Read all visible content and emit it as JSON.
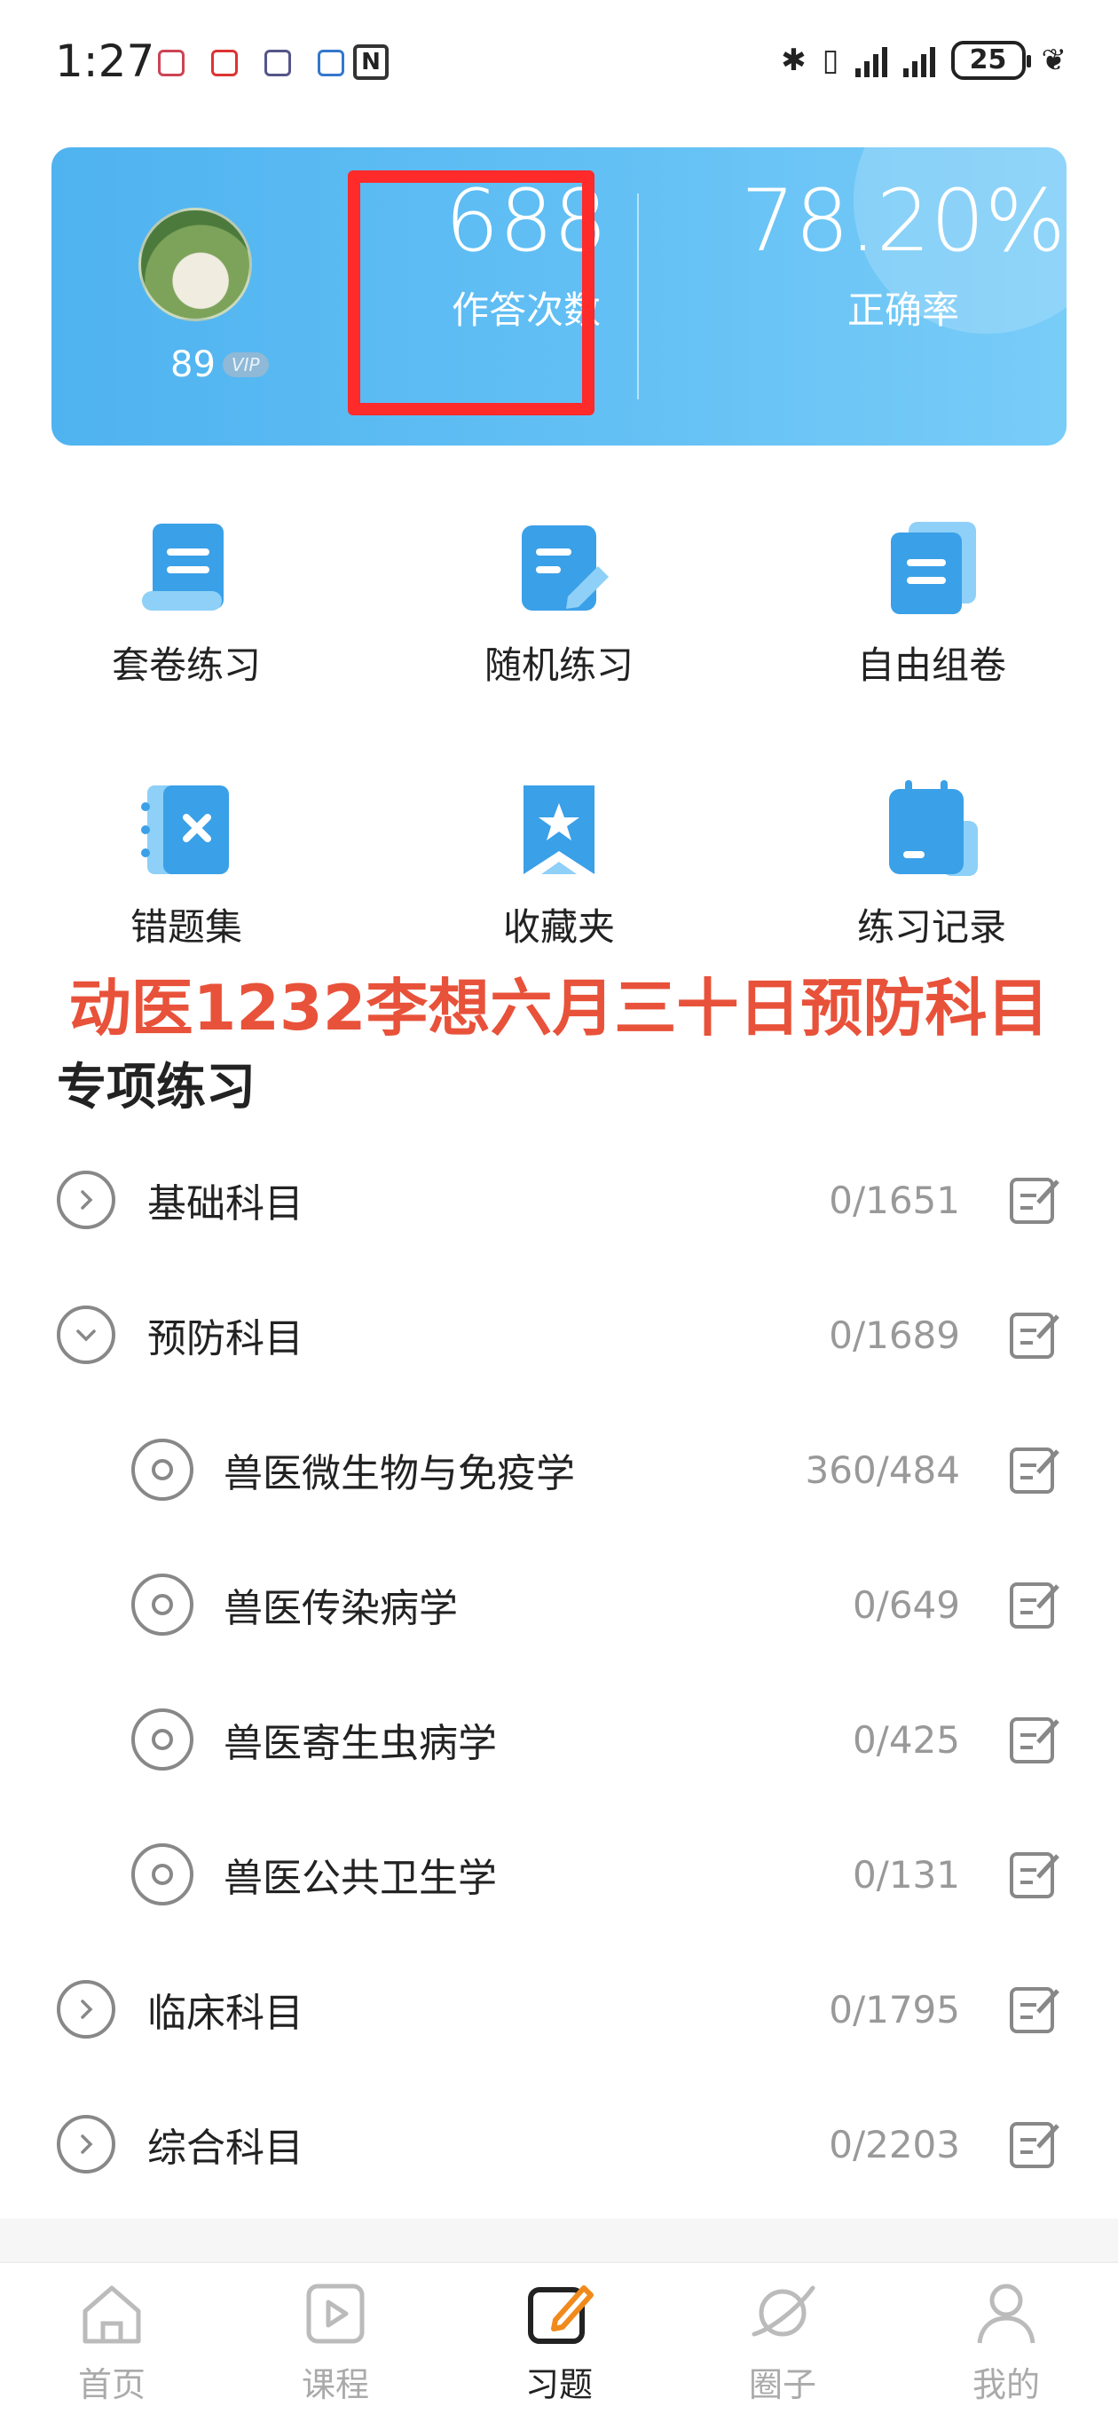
{
  "status_bar": {
    "time": "1:27",
    "battery": "25"
  },
  "header": {
    "user_level": "89",
    "vip": "VIP",
    "answers_count": "688",
    "answers_label": "作答次数",
    "accuracy": "78.20%",
    "accuracy_label": "正确率"
  },
  "features": [
    {
      "label": "套卷练习",
      "icon": "scroll-doc-icon"
    },
    {
      "label": "随机练习",
      "icon": "edit-doc-icon"
    },
    {
      "label": "自由组卷",
      "icon": "stacked-doc-icon"
    },
    {
      "label": "错题集",
      "icon": "notebook-x-icon"
    },
    {
      "label": "收藏夹",
      "icon": "bookmark-star-icon"
    },
    {
      "label": "练习记录",
      "icon": "calendar-icon"
    }
  ],
  "overlay_text": "动医1232李想六月三十日预防科目",
  "section_title": "专项练习",
  "subjects": [
    {
      "name": "基础科目",
      "count": "0/1651",
      "state": "collapsed"
    },
    {
      "name": "预防科目",
      "count": "0/1689",
      "state": "expanded"
    },
    {
      "name": "兽医微生物与免疫学",
      "count": "360/484",
      "state": "child"
    },
    {
      "name": "兽医传染病学",
      "count": "0/649",
      "state": "child"
    },
    {
      "name": "兽医寄生虫病学",
      "count": "0/425",
      "state": "child"
    },
    {
      "name": "兽医公共卫生学",
      "count": "0/131",
      "state": "child"
    },
    {
      "name": "临床科目",
      "count": "0/1795",
      "state": "collapsed"
    },
    {
      "name": "综合科目",
      "count": "0/2203",
      "state": "collapsed"
    }
  ],
  "tabs": [
    {
      "label": "首页",
      "icon": "home-icon",
      "active": false
    },
    {
      "label": "课程",
      "icon": "play-icon",
      "active": false
    },
    {
      "label": "习题",
      "icon": "edit-icon",
      "active": true
    },
    {
      "label": "圈子",
      "icon": "planet-icon",
      "active": false
    },
    {
      "label": "我的",
      "icon": "person-icon",
      "active": false
    }
  ],
  "colors": {
    "accent": "#4fb3f0",
    "highlight": "#ff2a2a",
    "overlay": "#e8523a",
    "active_tab": "#f08a1c"
  }
}
